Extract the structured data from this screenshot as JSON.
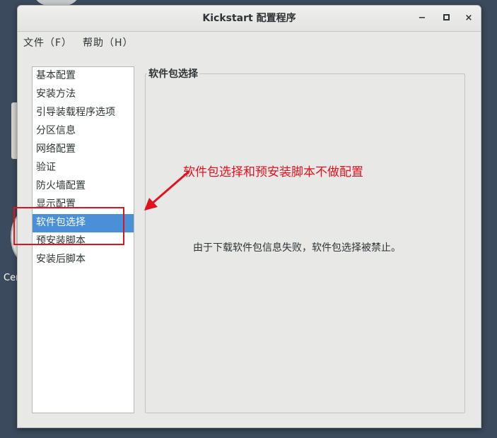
{
  "desktop": {
    "icon_label": "Cen"
  },
  "window": {
    "title": "Kickstart 配置程序",
    "controls": {
      "minimize": "−",
      "close": "×"
    }
  },
  "menubar": {
    "file": "文件（F）",
    "help": "帮助（H）"
  },
  "sidebar": {
    "selected_index": 8,
    "items": [
      {
        "label": "基本配置"
      },
      {
        "label": "安装方法"
      },
      {
        "label": "引导装载程序选项"
      },
      {
        "label": "分区信息"
      },
      {
        "label": "网络配置"
      },
      {
        "label": "验证"
      },
      {
        "label": "防火墙配置"
      },
      {
        "label": "显示配置"
      },
      {
        "label": "软件包选择"
      },
      {
        "label": "预安装脚本"
      },
      {
        "label": "安装后脚本"
      }
    ]
  },
  "panel": {
    "title": "软件包选择",
    "message": "由于下载软件包信息失败，软件包选择被禁止。"
  },
  "annotation": {
    "text": "软件包选择和预安装脚本不做配置",
    "color": "#e1111d"
  }
}
